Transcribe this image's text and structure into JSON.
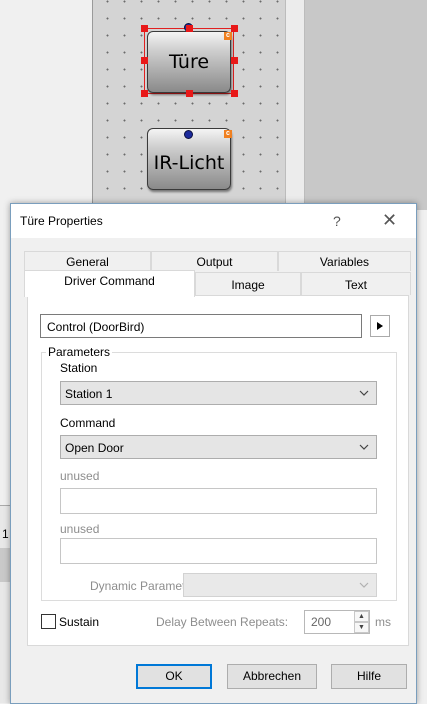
{
  "canvas": {
    "devices": [
      {
        "label": "Türe",
        "badge": "c"
      },
      {
        "label": "IR-Licht",
        "badge": "c"
      }
    ],
    "left_fragment": "1"
  },
  "dialog": {
    "title": "Türe Properties",
    "help": "?",
    "close": "✕",
    "tabs_row1": [
      "General",
      "Output",
      "Variables"
    ],
    "tabs_row2": [
      "Driver Command",
      "Image",
      "Text"
    ],
    "active_tab": "Driver Command",
    "driver": {
      "value": "Control (DoorBird)",
      "expand_icon": "triangle-right-icon"
    },
    "parameters": {
      "group_label": "Parameters",
      "station_label": "Station",
      "station_value": "Station 1",
      "command_label": "Command",
      "command_value": "Open Door",
      "unused1_label": "unused",
      "unused1_value": "",
      "unused2_label": "unused",
      "unused2_value": "",
      "dynamic_label": "Dynamic Parameter:",
      "dynamic_value": ""
    },
    "sustain": {
      "label": "Sustain",
      "checked": false
    },
    "delay": {
      "label": "Delay Between Repeats:",
      "value": "200",
      "unit": "ms"
    },
    "buttons": {
      "ok": "OK",
      "cancel": "Abbrechen",
      "help": "Hilfe"
    }
  }
}
